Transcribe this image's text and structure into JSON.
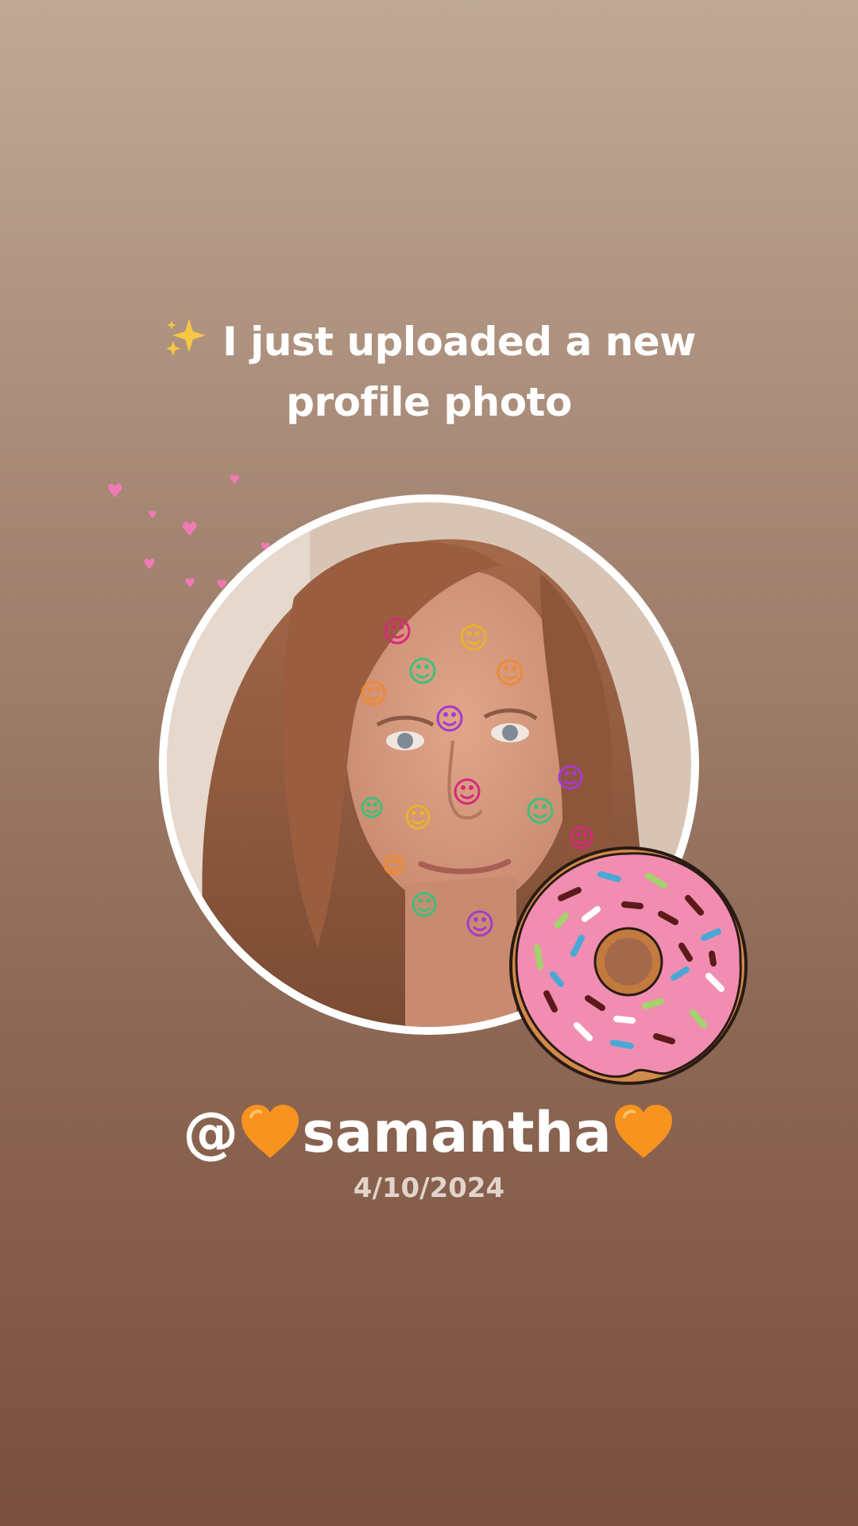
{
  "story": {
    "headline": {
      "icon": "sparkles-icon",
      "line1": "I just uploaded a new",
      "line2": "profile photo"
    },
    "profile_photo": {
      "description_icon": "person-photo",
      "ring_color": "#ffffff"
    },
    "sticker": "donut-sticker",
    "username": {
      "prefix": "@",
      "name": "samantha",
      "emoji": "orange-heart-icon"
    },
    "date": "4/10/2024"
  },
  "colors": {
    "background_top": "#bfa995",
    "background_bottom": "#7a4f3d",
    "text": "#ffffff",
    "date_text": "#e2d3cb",
    "heart_pink": "#f07ab4",
    "orange_heart": "#f7931e"
  }
}
